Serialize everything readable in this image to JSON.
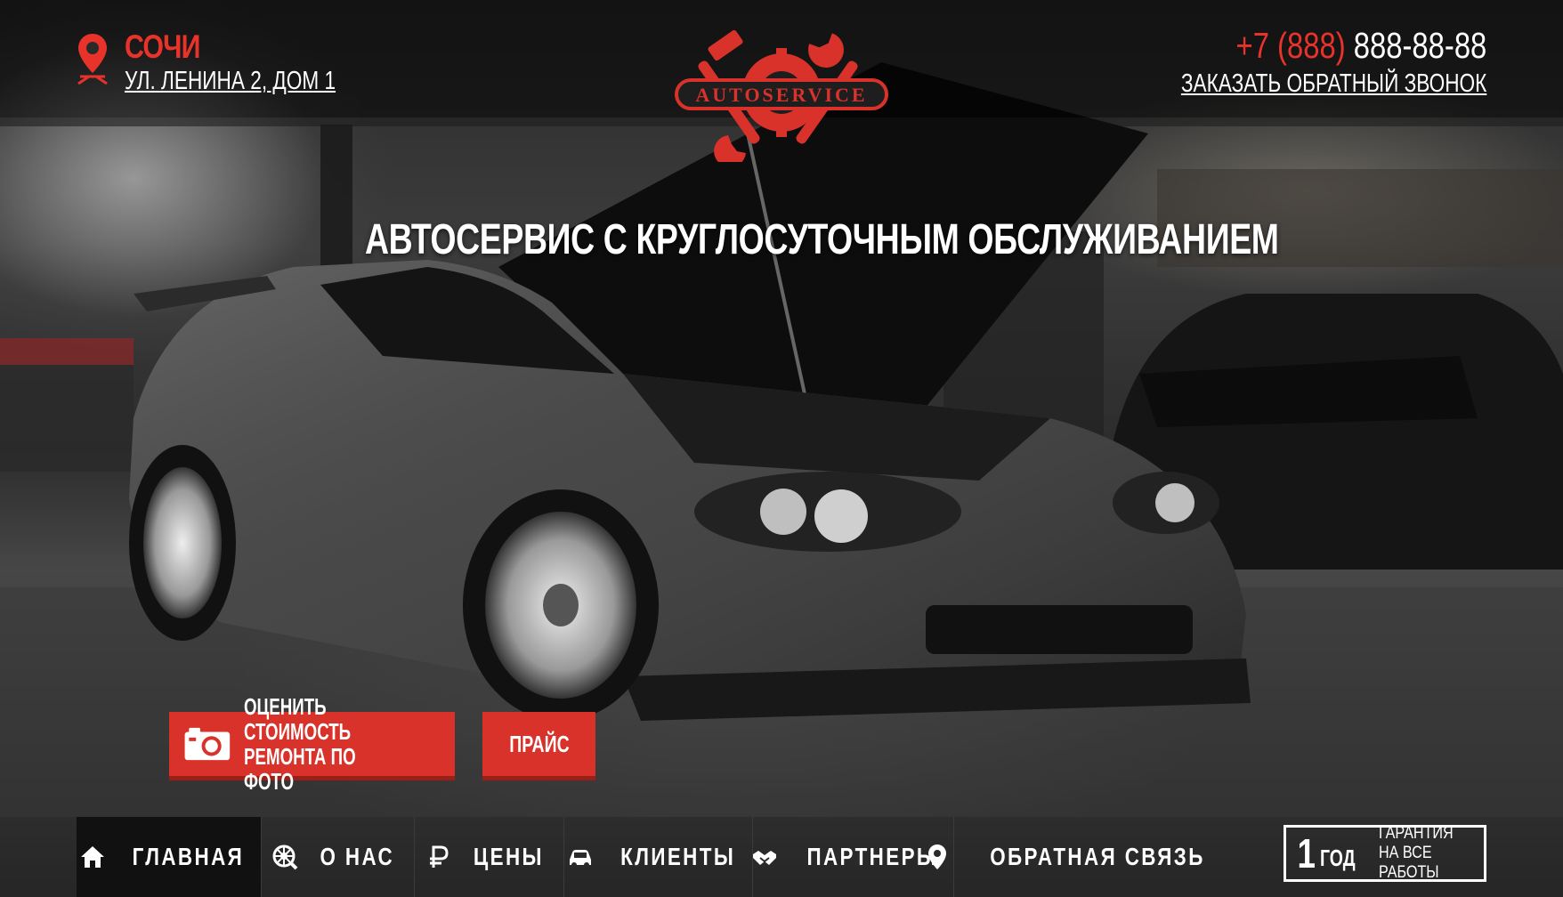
{
  "header": {
    "city": "СОЧИ",
    "address": "УЛ. ЛЕНИНА 2, ДОМ 1",
    "phone_code": "+7 (888)",
    "phone_number": "888-88-88",
    "callback_link": "ЗАКАЗАТЬ ОБРАТНЫЙ ЗВОНОК",
    "logo_text": "AUTOSERVICE"
  },
  "hero": {
    "headline": "АВТОСЕРВИС С КРУГЛОСУТОЧНЫМ ОБСЛУЖИВАНИЕМ",
    "photo_button_label": "ОЦЕНИТЬ СТОИМОСТЬ\nРЕМОНТА ПО ФОТО",
    "price_button_label": "ПРАЙС"
  },
  "nav": {
    "items": [
      {
        "label": "ГЛАВНАЯ",
        "icon": "home-icon",
        "active": true
      },
      {
        "label": "О НАС",
        "icon": "wheel-icon",
        "active": false
      },
      {
        "label": "ЦЕНЫ",
        "icon": "ruble-icon",
        "active": false
      },
      {
        "label": "КЛИЕНТЫ",
        "icon": "car-icon",
        "active": false
      },
      {
        "label": "ПАРТНЕРЫ",
        "icon": "handshake-icon",
        "active": false
      },
      {
        "label": "ОБРАТНАЯ СВЯЗЬ",
        "icon": "location-pin-icon",
        "active": false
      }
    ]
  },
  "warranty": {
    "number": "1",
    "unit": "ГОД",
    "text": "ГАРАНТИЯ\nНА ВСЕ РАБОТЫ"
  },
  "colors": {
    "accent": "#d8322a",
    "nav_background": "#2a2a2a",
    "nav_active": "#111111"
  }
}
